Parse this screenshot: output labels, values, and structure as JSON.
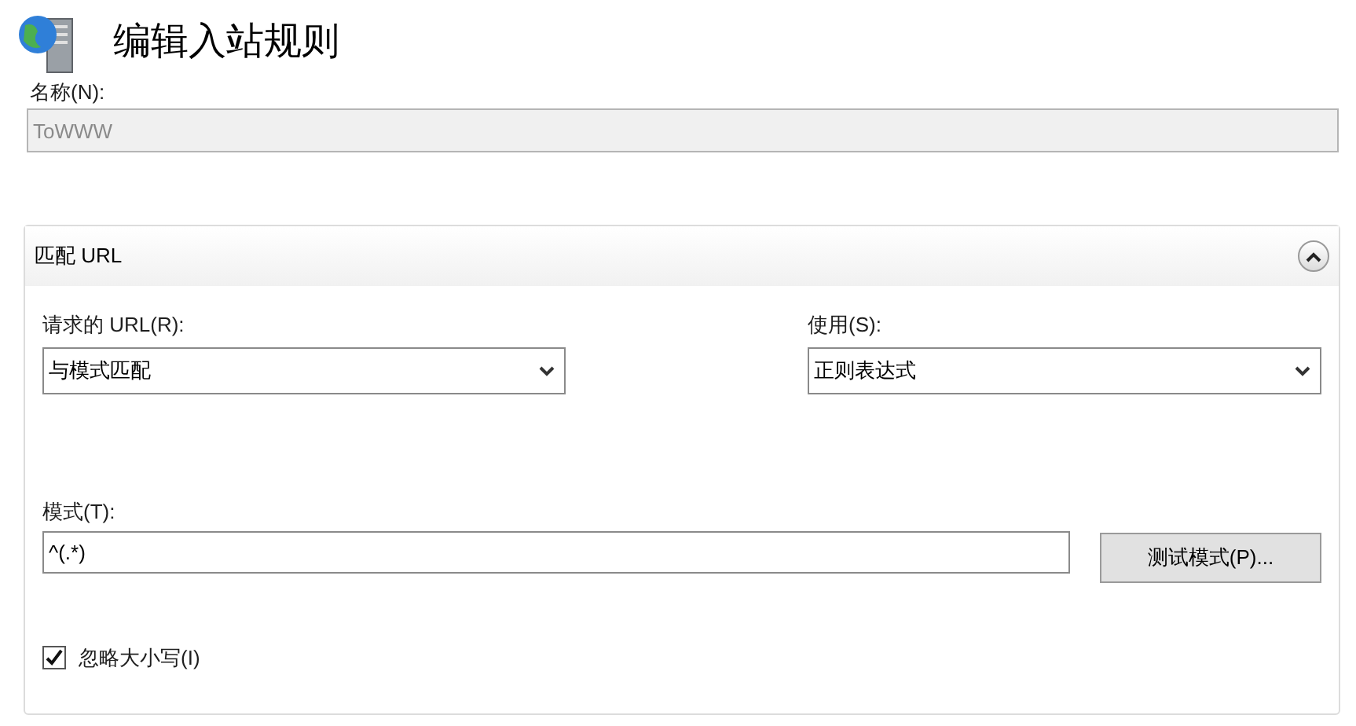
{
  "title": "编辑入站规则",
  "name_field": {
    "label": "名称(N):",
    "value": "ToWWW",
    "disabled": true
  },
  "section": {
    "title": "匹配 URL",
    "expanded": true,
    "requested_url": {
      "label": "请求的 URL(R):",
      "value": "与模式匹配"
    },
    "using": {
      "label": "使用(S):",
      "value": "正则表达式"
    },
    "pattern": {
      "label": "模式(T):",
      "value": "^(.*)"
    },
    "test_button": "测试模式(P)...",
    "ignore_case": {
      "label": "忽略大小写(I)",
      "checked": true
    }
  }
}
